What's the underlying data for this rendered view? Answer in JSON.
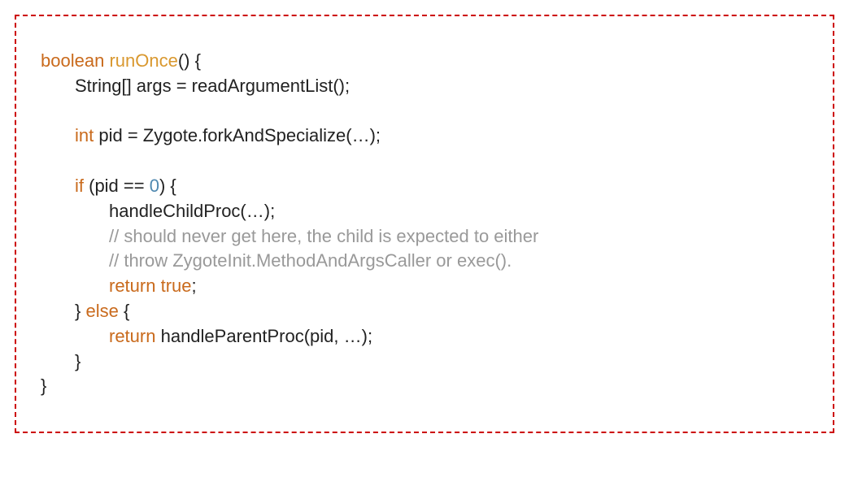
{
  "code": {
    "line1": {
      "kw": "boolean",
      "name": "runOnce",
      "rest": "() {"
    },
    "line2": {
      "text": "String[] args = readArgumentList();"
    },
    "line3": {
      "kw": "int",
      "rest": " pid = Zygote.forkAndSpecialize(…);"
    },
    "line4": {
      "kw": "if",
      "mid": " (pid == ",
      "num": "0",
      "rest": ") {"
    },
    "line5": {
      "text": "handleChildProc(…);"
    },
    "line6": {
      "comment": "// should never get here, the child is expected to either"
    },
    "line7": {
      "comment": "// throw ZygoteInit.MethodAndArgsCaller or exec()."
    },
    "line8": {
      "kw": "return",
      "lit": "true",
      "rest": ";"
    },
    "line9": {
      "close": "} ",
      "kw": "else",
      "rest": " {"
    },
    "line10": {
      "kw": "return",
      "rest": " handleParentProc(pid, …);"
    },
    "line11": {
      "text": "}"
    },
    "line12": {
      "text": "}"
    }
  }
}
